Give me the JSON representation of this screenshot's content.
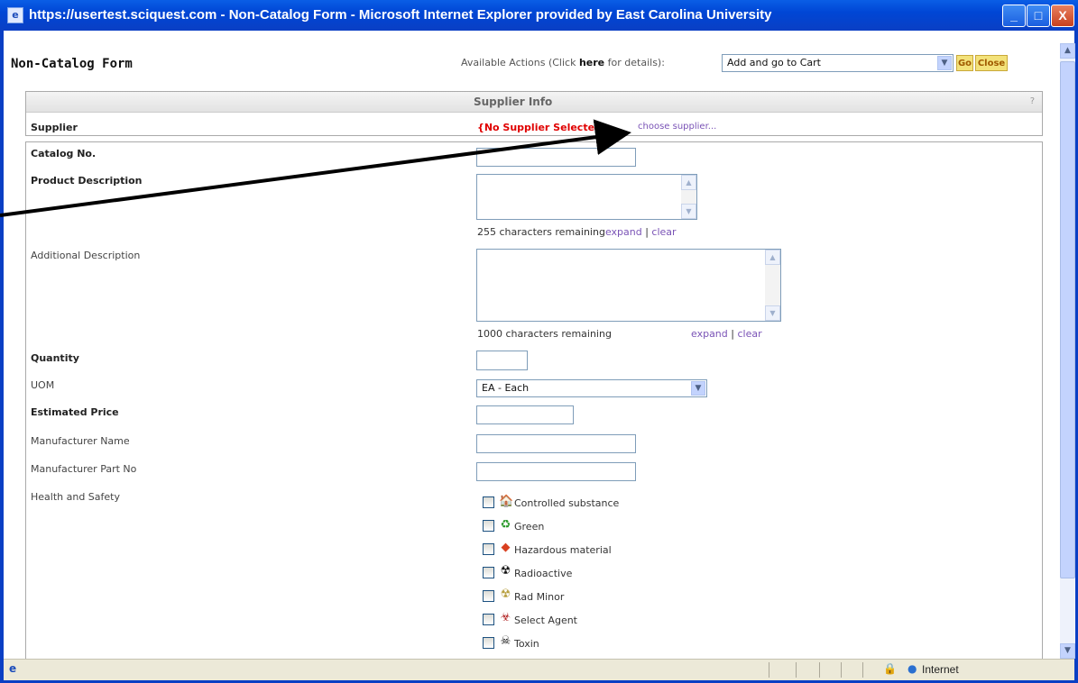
{
  "window": {
    "title": "https://usertest.sciquest.com - Non-Catalog Form - Microsoft Internet Explorer provided by East Carolina University",
    "min_glyph": "_",
    "max_glyph": "□",
    "close_glyph": "X"
  },
  "header": {
    "form_title": "Non-Catalog Form",
    "available_actions_prefix": "Available Actions (Click ",
    "available_actions_here": "here",
    "available_actions_suffix": " for details):",
    "actions_selected": "Add and go to Cart",
    "go_label": "Go",
    "close_label": "Close"
  },
  "supplier_info": {
    "section_title": "Supplier Info",
    "help": "?",
    "supplier_label": "Supplier",
    "no_supplier": "{No Supplier Selected}",
    "choose_supplier": "choose supplier..."
  },
  "form": {
    "catalog_no_label": "Catalog No.",
    "catalog_no_value": "",
    "product_description_label": "Product Description",
    "product_description_value": "",
    "product_description_remaining": "255 characters remaining",
    "additional_description_label": "Additional Description",
    "additional_description_value": "",
    "additional_description_remaining": "1000 characters remaining",
    "expand_label": "expand",
    "clear_label": "clear",
    "separator": "|",
    "quantity_label": "Quantity",
    "quantity_value": "",
    "uom_label": "UOM",
    "uom_selected": "EA - Each",
    "estimated_price_label": "Estimated Price",
    "estimated_price_value": "",
    "manufacturer_name_label": "Manufacturer Name",
    "manufacturer_name_value": "",
    "manufacturer_part_label": "Manufacturer Part No",
    "manufacturer_part_value": "",
    "health_safety_label": "Health and Safety",
    "health_safety_options": [
      {
        "label": "Controlled substance",
        "icon": "controlled-substance-icon",
        "glyph": "🏠",
        "color": "#b01818"
      },
      {
        "label": "Green",
        "icon": "recycle-icon",
        "glyph": "♻",
        "color": "#2a9a2a"
      },
      {
        "label": "Hazardous material",
        "icon": "hazard-diamond-icon",
        "glyph": "◆",
        "color": "#d94020"
      },
      {
        "label": "Radioactive",
        "icon": "radioactive-icon",
        "glyph": "☢",
        "color": "#111111"
      },
      {
        "label": "Rad Minor",
        "icon": "radioactive-minor-icon",
        "glyph": "☢",
        "color": "#b8a040"
      },
      {
        "label": "Select Agent",
        "icon": "biohazard-icon",
        "glyph": "☣",
        "color": "#b02020"
      },
      {
        "label": "Toxin",
        "icon": "skull-icon",
        "glyph": "☠",
        "color": "#111111"
      }
    ]
  },
  "statusbar": {
    "zone": "Internet"
  }
}
